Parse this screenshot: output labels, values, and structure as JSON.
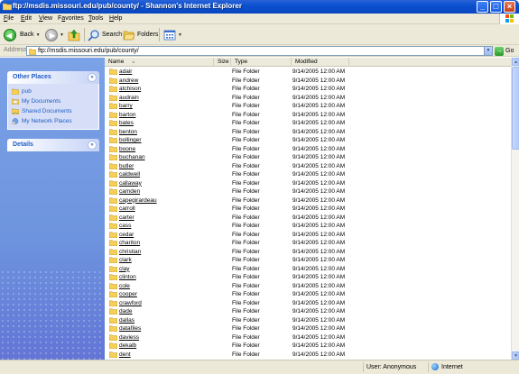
{
  "window": {
    "title": "ftp://msdis.missouri.edu/pub/county/ - Shannon's Internet Explorer",
    "minimize": "_",
    "maximize": "□",
    "close": "×"
  },
  "menu": {
    "items": [
      {
        "label": "File",
        "accel": "F",
        "rest": "ile"
      },
      {
        "label": "Edit",
        "accel": "E",
        "rest": "dit"
      },
      {
        "label": "View",
        "accel": "V",
        "rest": "iew"
      },
      {
        "label": "Favorites",
        "accel": "a",
        "pre": "F",
        "rest": "vorites"
      },
      {
        "label": "Tools",
        "accel": "T",
        "rest": "ools"
      },
      {
        "label": "Help",
        "accel": "H",
        "rest": "elp"
      }
    ]
  },
  "toolbar": {
    "back_label": "Back",
    "search_label": "Search",
    "folders_label": "Folders"
  },
  "address": {
    "label": "Address",
    "value": "ftp://msdis.missouri.edu/pub/county/",
    "go_label": "Go"
  },
  "taskpane": {
    "other_places": {
      "title": "Other Places",
      "items": [
        "pub",
        "My Documents",
        "Shared Documents",
        "My Network Places"
      ]
    },
    "details": {
      "title": "Details"
    }
  },
  "columns": {
    "name": "Name",
    "size": "Size",
    "type": "Type",
    "modified": "Modified"
  },
  "files": [
    {
      "name": "adair",
      "type": "File Folder",
      "modified": "9/14/2005 12:00 AM"
    },
    {
      "name": "andrew",
      "type": "File Folder",
      "modified": "9/14/2005 12:00 AM"
    },
    {
      "name": "atchison",
      "type": "File Folder",
      "modified": "9/14/2005 12:00 AM"
    },
    {
      "name": "audrain",
      "type": "File Folder",
      "modified": "9/14/2005 12:00 AM"
    },
    {
      "name": "barry",
      "type": "File Folder",
      "modified": "9/14/2005 12:00 AM"
    },
    {
      "name": "barton",
      "type": "File Folder",
      "modified": "9/14/2005 12:00 AM"
    },
    {
      "name": "bates",
      "type": "File Folder",
      "modified": "9/14/2005 12:00 AM"
    },
    {
      "name": "benton",
      "type": "File Folder",
      "modified": "9/14/2005 12:00 AM"
    },
    {
      "name": "bollinger",
      "type": "File Folder",
      "modified": "9/14/2005 12:00 AM"
    },
    {
      "name": "boone",
      "type": "File Folder",
      "modified": "9/14/2005 12:00 AM"
    },
    {
      "name": "buchanan",
      "type": "File Folder",
      "modified": "9/14/2005 12:00 AM"
    },
    {
      "name": "butler",
      "type": "File Folder",
      "modified": "9/14/2005 12:00 AM"
    },
    {
      "name": "caldwell",
      "type": "File Folder",
      "modified": "9/14/2005 12:00 AM"
    },
    {
      "name": "callaway",
      "type": "File Folder",
      "modified": "9/14/2005 12:00 AM"
    },
    {
      "name": "camden",
      "type": "File Folder",
      "modified": "9/14/2005 12:00 AM"
    },
    {
      "name": "capegirardeau",
      "type": "File Folder",
      "modified": "9/14/2005 12:00 AM"
    },
    {
      "name": "carroll",
      "type": "File Folder",
      "modified": "9/14/2005 12:00 AM"
    },
    {
      "name": "carter",
      "type": "File Folder",
      "modified": "9/14/2005 12:00 AM"
    },
    {
      "name": "cass",
      "type": "File Folder",
      "modified": "9/14/2005 12:00 AM"
    },
    {
      "name": "cedar",
      "type": "File Folder",
      "modified": "9/14/2005 12:00 AM"
    },
    {
      "name": "chariton",
      "type": "File Folder",
      "modified": "9/14/2005 12:00 AM"
    },
    {
      "name": "christian",
      "type": "File Folder",
      "modified": "9/14/2005 12:00 AM"
    },
    {
      "name": "clark",
      "type": "File Folder",
      "modified": "9/14/2005 12:00 AM"
    },
    {
      "name": "clay",
      "type": "File Folder",
      "modified": "9/14/2005 12:00 AM"
    },
    {
      "name": "clinton",
      "type": "File Folder",
      "modified": "9/14/2005 12:00 AM"
    },
    {
      "name": "cole",
      "type": "File Folder",
      "modified": "9/14/2005 12:00 AM"
    },
    {
      "name": "cooper",
      "type": "File Folder",
      "modified": "9/14/2005 12:00 AM"
    },
    {
      "name": "crawford",
      "type": "File Folder",
      "modified": "9/14/2005 12:00 AM"
    },
    {
      "name": "dade",
      "type": "File Folder",
      "modified": "9/14/2005 12:00 AM"
    },
    {
      "name": "dallas",
      "type": "File Folder",
      "modified": "9/14/2005 12:00 AM"
    },
    {
      "name": "datafiles",
      "type": "File Folder",
      "modified": "9/14/2005 12:00 AM"
    },
    {
      "name": "daviess",
      "type": "File Folder",
      "modified": "9/14/2005 12:00 AM"
    },
    {
      "name": "dekalb",
      "type": "File Folder",
      "modified": "9/14/2005 12:00 AM"
    },
    {
      "name": "dent",
      "type": "File Folder",
      "modified": "9/14/2005 12:00 AM"
    }
  ],
  "status": {
    "user": "User: Anonymous",
    "zone": "Internet"
  },
  "colors": {
    "titlebar": "#0a50d0",
    "chrome": "#ece9d8",
    "taskpane": "#7ba2e7",
    "link": "#215dc6"
  }
}
